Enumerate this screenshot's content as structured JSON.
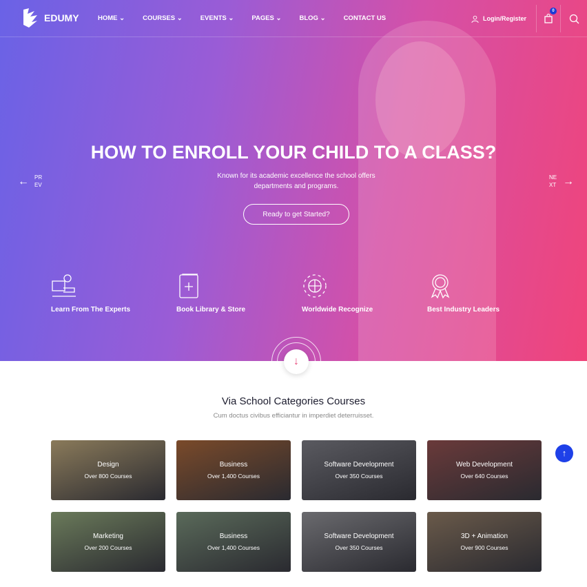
{
  "brand": "EDUMY",
  "nav": {
    "items": [
      "HOME",
      "COURSES",
      "EVENTS",
      "PAGES",
      "BLOG",
      "CONTACT US"
    ],
    "login": "Login/Register",
    "cart_count": "0"
  },
  "hero": {
    "title": "HOW TO ENROLL YOUR CHILD TO A CLASS?",
    "subtitle": "Known for its academic excellence the school offers departments and programs.",
    "cta": "Ready to get Started?",
    "prev": "PR EV",
    "next": "NE XT"
  },
  "features": [
    {
      "label": "Learn From The Experts",
      "icon": "teacher-icon"
    },
    {
      "label": "Book Library & Store",
      "icon": "book-icon"
    },
    {
      "label": "Worldwide Recognize",
      "icon": "globe-icon"
    },
    {
      "label": "Best Industry Leaders",
      "icon": "award-icon"
    }
  ],
  "section": {
    "title": "Via School Categories Courses",
    "subtitle": "Cum doctus civibus efficiantur in imperdiet deterruisset."
  },
  "categories": [
    {
      "title": "Design",
      "count": "Over 800 Courses",
      "color": "#8a7a5a"
    },
    {
      "title": "Business",
      "count": "Over 1,400 Courses",
      "color": "#7a4a2a"
    },
    {
      "title": "Software Development",
      "count": "Over 350 Courses",
      "color": "#5a5a60"
    },
    {
      "title": "Web Development",
      "count": "Over 640 Courses",
      "color": "#6a3a3a"
    },
    {
      "title": "Marketing",
      "count": "Over 200 Courses",
      "color": "#6a7a5a"
    },
    {
      "title": "Business",
      "count": "Over 1,400 Courses",
      "color": "#5a6a5a"
    },
    {
      "title": "Software Development",
      "count": "Over 350 Courses",
      "color": "#6a6a6e"
    },
    {
      "title": "3D + Animation",
      "count": "Over 900 Courses",
      "color": "#6a5a4a"
    }
  ],
  "colors": {
    "gradient_start": "#6a62e6",
    "gradient_end": "#f0447a",
    "accent_blue": "#1e40e8"
  }
}
